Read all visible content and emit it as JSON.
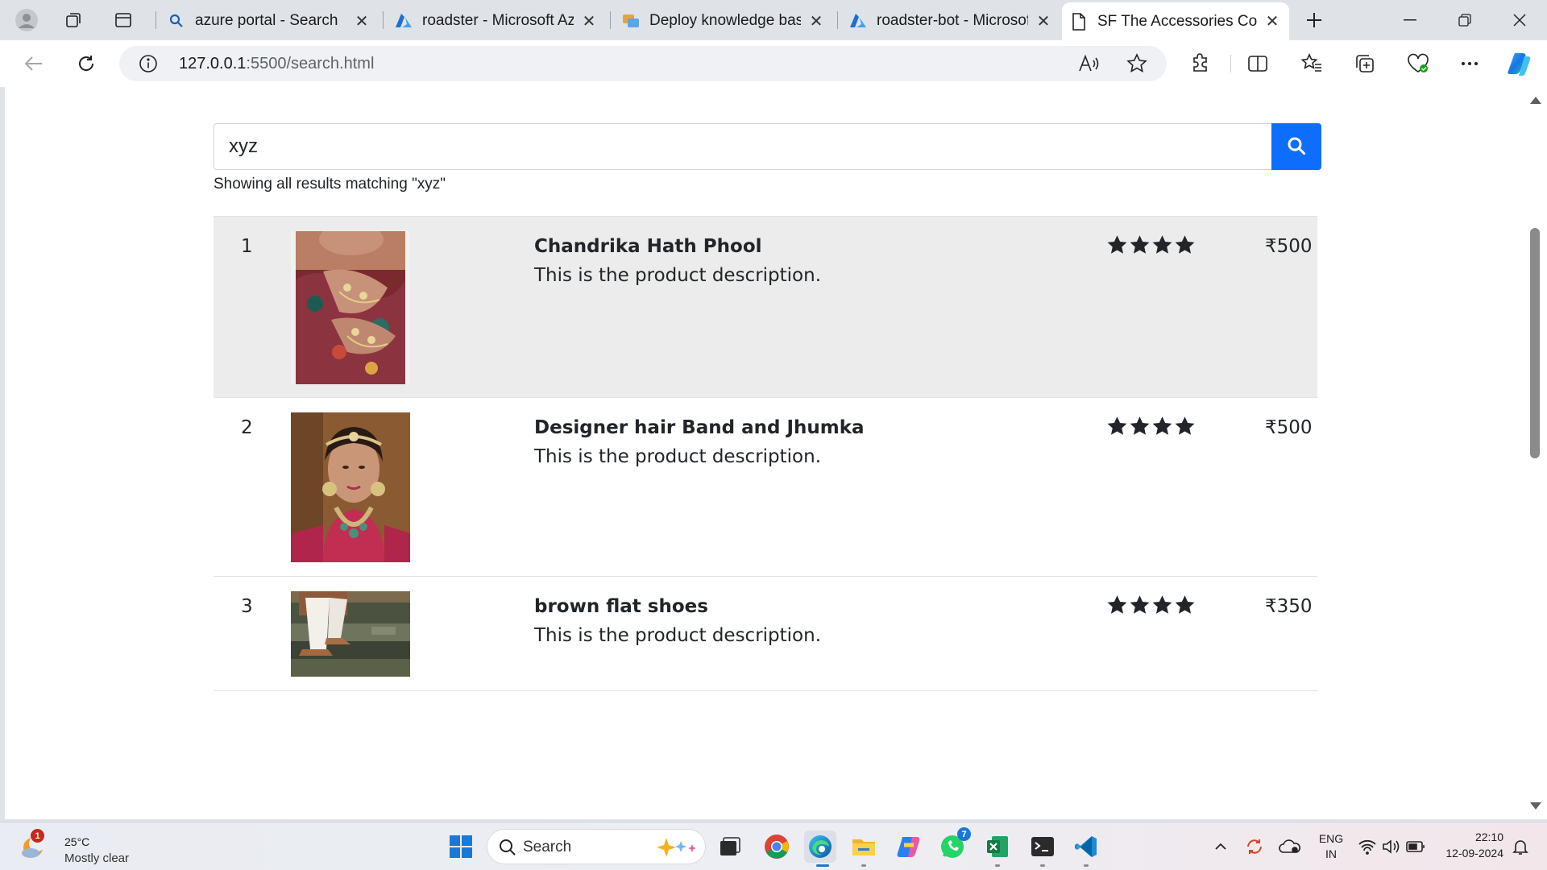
{
  "browser": {
    "tabs": [
      {
        "title": "azure portal - Search",
        "icon": "search-icon"
      },
      {
        "title": "roadster - Microsoft Azure",
        "icon": "azure-icon"
      },
      {
        "title": "Deploy knowledge base",
        "icon": "qna-icon"
      },
      {
        "title": "roadster-bot - Microsoft Azure",
        "icon": "azure-icon"
      },
      {
        "title": "SF The Accessories Corner",
        "icon": "page-icon",
        "active": true
      }
    ],
    "url_host": "127.0.0.1",
    "url_rest": ":5500/search.html"
  },
  "search": {
    "value": "xyz",
    "result_note": "Showing all results matching \"xyz\""
  },
  "results": [
    {
      "num": "1",
      "name": "Chandrika Hath Phool",
      "description": "This is the product description.",
      "rating": 4,
      "price": "₹500",
      "image": "hand-jewelry-photo"
    },
    {
      "num": "2",
      "name": "Designer hair Band and Jhumka",
      "description": "This is the product description.",
      "rating": 4,
      "price": "₹500",
      "image": "bridal-jewelry-photo"
    },
    {
      "num": "3",
      "name": "brown flat shoes",
      "description": "This is the product description.",
      "rating": 4,
      "price": "₹350",
      "image": "shoes-on-steps-photo"
    }
  ],
  "taskbar": {
    "weather_temp": "25°C",
    "weather_desc": "Mostly clear",
    "weather_badge": "1",
    "search_label": "Search",
    "whatsapp_badge": "7",
    "lang_top": "ENG",
    "lang_bottom": "IN",
    "time": "22:10",
    "date": "12-09-2024"
  },
  "colors": {
    "accent": "#0d6efd",
    "highlight_row": "#ececec"
  }
}
